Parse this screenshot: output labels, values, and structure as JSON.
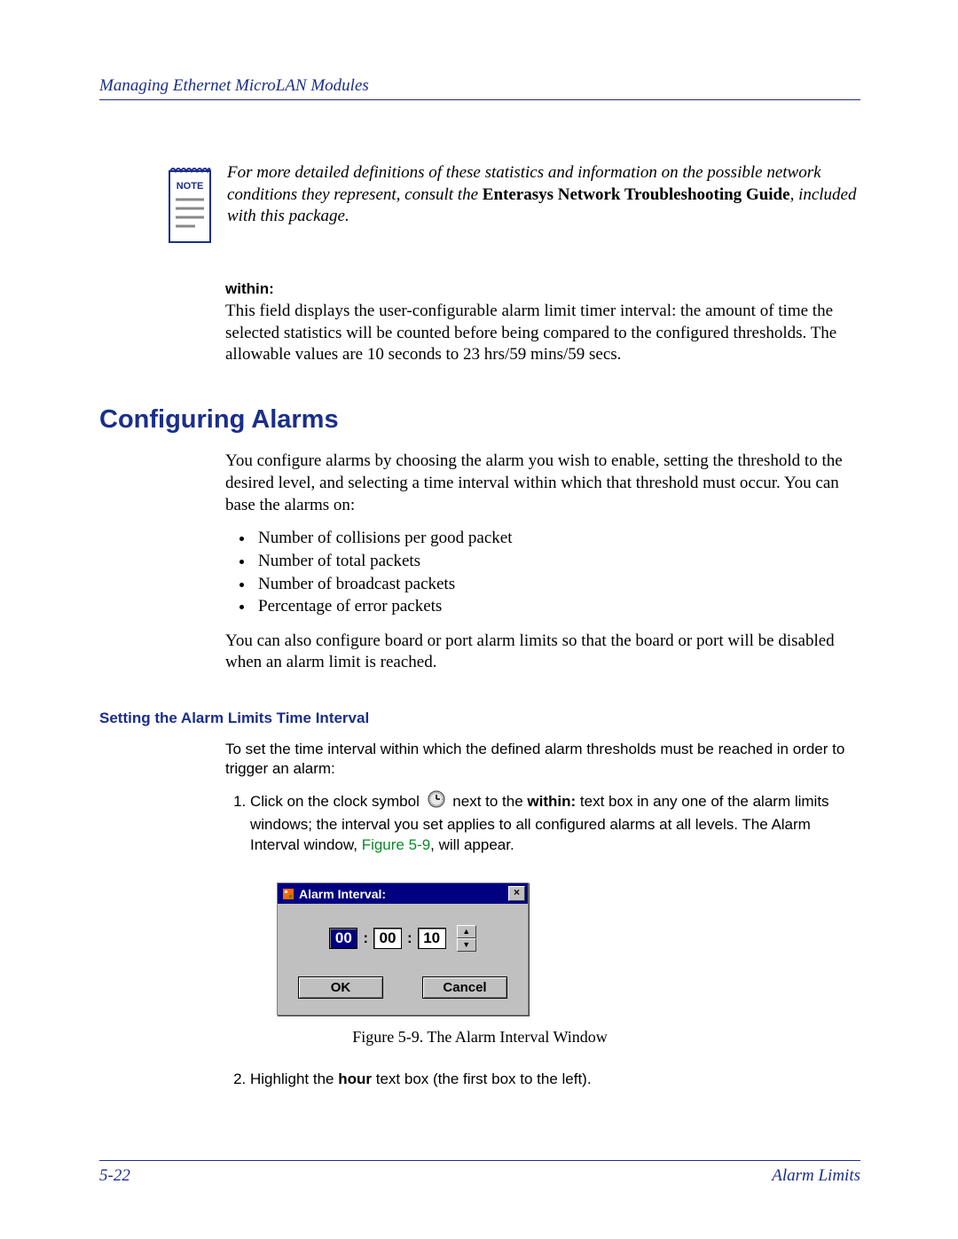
{
  "header": {
    "title": "Managing Ethernet MicroLAN Modules"
  },
  "note": {
    "label": "NOTE",
    "text_pre": "For more detailed definitions of these statistics and information on the possible network conditions they represent, consult the ",
    "guide": "Enterasys Network Troubleshooting Guide",
    "text_post": ", included with this package."
  },
  "within": {
    "label": "within:",
    "text": "This field displays the user-configurable alarm limit timer interval: the amount of time the selected statistics will be counted before being compared to the configured thresholds. The allowable values are 10 seconds to 23 hrs/59 mins/59 secs."
  },
  "section": {
    "title": "Configuring Alarms",
    "intro": "You configure alarms by choosing the alarm you wish to enable, setting the threshold to the desired level, and selecting a time interval within which that threshold must occur. You can base the alarms on:",
    "bullets": [
      "Number of collisions per good packet",
      "Number of total packets",
      "Number of broadcast packets",
      "Percentage of error packets"
    ],
    "outro": "You can also configure board or port alarm limits so that the board or port will be disabled when an alarm limit is reached."
  },
  "subsection": {
    "title": "Setting the Alarm Limits Time Interval",
    "intro": "To set the time interval within which the defined alarm thresholds must be reached in order to trigger an alarm:",
    "step1_a": "Click on the clock symbol ",
    "step1_b": " next to the ",
    "step1_within": "within:",
    "step1_c": " text box in any one of the alarm limits windows; the interval you set applies to all configured alarms at all levels. The Alarm Interval window, ",
    "step1_figref": "Figure 5-9",
    "step1_d": ", will appear.",
    "step2_a": "Highlight the ",
    "step2_hour": "hour",
    "step2_b": " text box (the first box to the left)."
  },
  "dialog": {
    "title": "Alarm Interval:",
    "close": "×",
    "hours": "00",
    "minutes": "00",
    "seconds": "10",
    "sep": ":",
    "up": "▲",
    "down": "▼",
    "ok": "OK",
    "cancel": "Cancel"
  },
  "figure_caption": "Figure 5-9. The Alarm Interval Window",
  "footer": {
    "page": "5-22",
    "section": "Alarm Limits"
  }
}
